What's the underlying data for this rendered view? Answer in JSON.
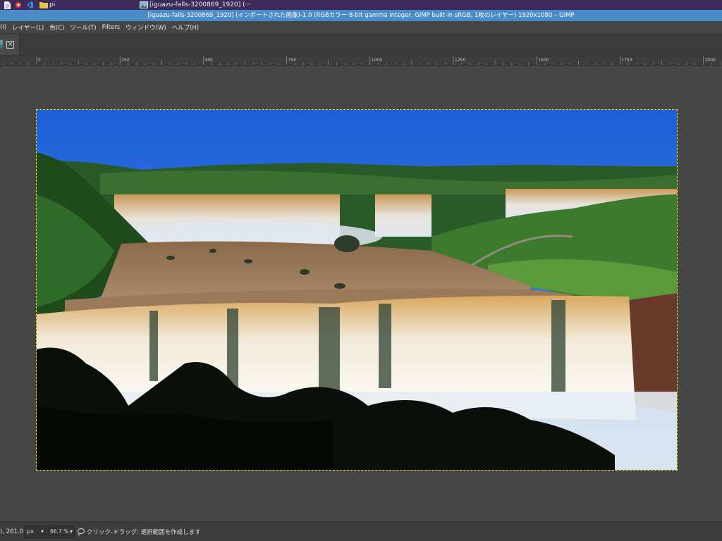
{
  "taskbar": {
    "folder_label": "pi",
    "task_label": "[iguazu-falls-3200869_1920] (···"
  },
  "window": {
    "title": "[iguazu-falls-3200869_1920] (インポートされた画像)-1.0 (RGBカラー 8-bit gamma integer, GIMP built-in sRGB, 1枚のレイヤー) 1920x1080 – GIMP"
  },
  "menu": {
    "items": [
      "(I)",
      "レイヤー(L)",
      "色(C)",
      "ツール(T)",
      "Filters",
      "ウィンドウ(W)",
      "ヘルプ(H)"
    ]
  },
  "ruler": {
    "labels": [
      "0",
      "250",
      "500",
      "750",
      "1000",
      "1250",
      "1500",
      "1750",
      "2000"
    ]
  },
  "status": {
    "coords": "), 261.0",
    "unit": "px",
    "zoom": "66.7 %",
    "message": "クリック-ドラッグ: 選択範囲を作成します"
  },
  "icons": {
    "file_manager": "file-icon",
    "app_red": "red-app-icon",
    "vscode": "vscode-icon",
    "folder": "folder-icon",
    "image": "image-icon",
    "lasso": "free-select-icon"
  },
  "colors": {
    "title_bar": "#4a8cc8",
    "taskbar": "#3b2a5a",
    "selection_outline": "#e6e600"
  }
}
